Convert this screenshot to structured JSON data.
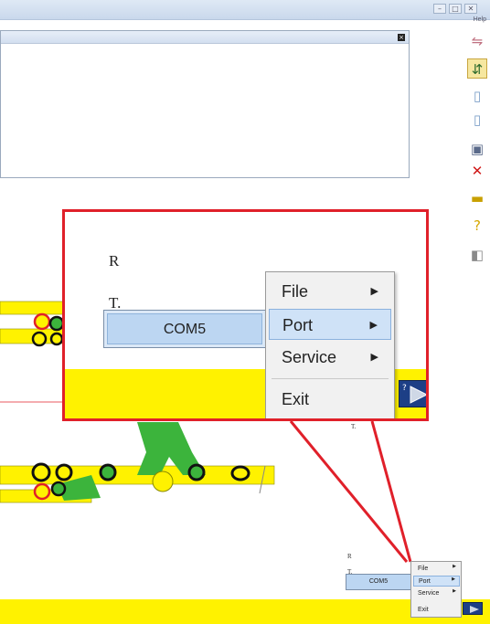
{
  "window": {
    "help_label": "Help",
    "controls": {
      "minimize": "–",
      "maximize": "□",
      "close": "✕"
    }
  },
  "dialog": {
    "title": "",
    "close_glyph": "×"
  },
  "toolbar": {
    "icons": [
      "cable-icon",
      "connect-icon",
      "probe-icon",
      "probe-alt-icon",
      "device-icon",
      "delete-icon",
      "export-icon",
      "help-icon",
      "view-icon"
    ]
  },
  "callout": {
    "label_r": "R",
    "label_t": "T.",
    "com_port": "COM5",
    "menu": [
      {
        "label": "File",
        "has_submenu": true
      },
      {
        "label": "Port",
        "has_submenu": true,
        "active": true
      },
      {
        "label": "Service",
        "has_submenu": true
      },
      {
        "label": "Exit",
        "has_submenu": false
      }
    ],
    "arrow_glyph": "▶"
  },
  "actual": {
    "label_r": "R",
    "label_t": "T.",
    "com_port": "COM5",
    "menu": [
      {
        "label": "File"
      },
      {
        "label": "Port"
      },
      {
        "label": "Service"
      },
      {
        "label": "Exit"
      }
    ]
  },
  "colors": {
    "callout_border": "#e0202a",
    "board_yellow": "#fff200",
    "trace_green": "#3cb43c",
    "pad_ring_black": "#111111",
    "pad_ring_red": "#e0202a",
    "menu_highlight": "#cfe2f7",
    "com_highlight": "#bcd6f2"
  }
}
